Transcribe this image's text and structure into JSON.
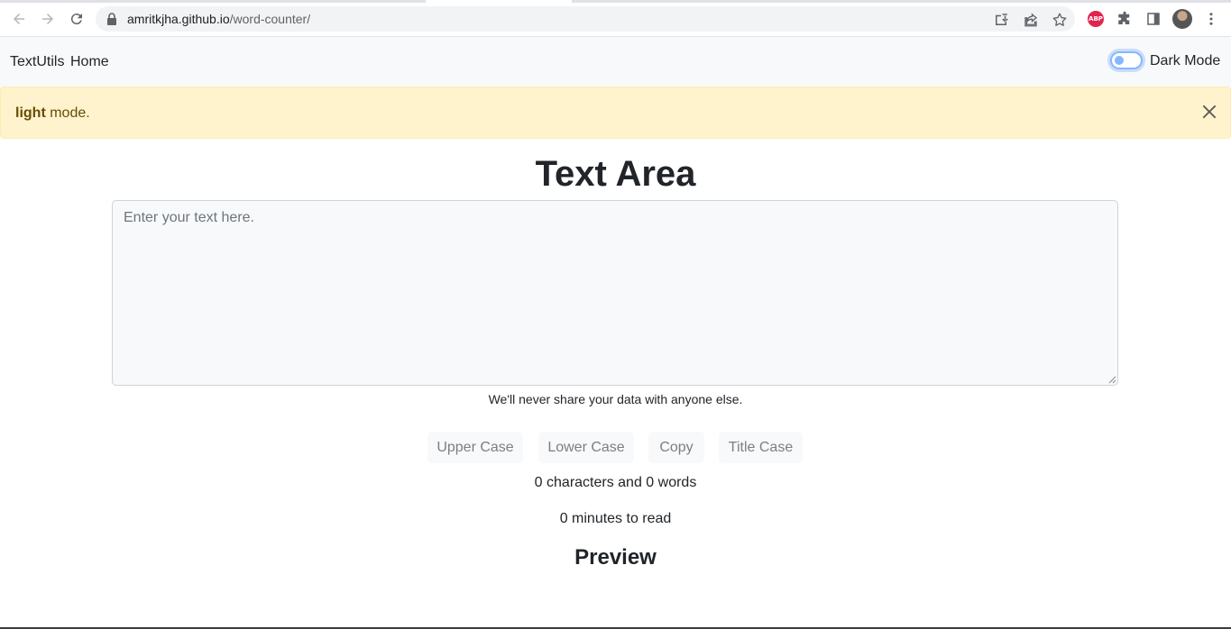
{
  "browser": {
    "url_host": "amritkjha.github.io",
    "url_path": "/word-counter/",
    "icons": [
      "back-icon",
      "forward-icon",
      "reload-icon",
      "lock-icon",
      "install-icon",
      "share-icon",
      "star-icon",
      "adblock-icon",
      "extensions-icon",
      "side-panel-icon",
      "profile-avatar",
      "menu-icon"
    ],
    "adblock_label": "ABP"
  },
  "navbar": {
    "brand": "TextUtils",
    "home": "Home",
    "toggle_label": "Dark Mode",
    "toggle_on": false
  },
  "alert": {
    "strong": "light",
    "rest": " mode."
  },
  "main": {
    "title": "Text Area",
    "textarea_placeholder": "Enter your text here.",
    "help_text": "We'll never share your data with anyone else.",
    "buttons": [
      "Upper Case",
      "Lower Case",
      "Copy",
      "Title Case"
    ],
    "stats": "0 characters and 0 words",
    "read_time": "0 minutes to read",
    "preview_heading": "Preview"
  },
  "colors": {
    "navbar_bg": "#f8f9fa",
    "alert_bg": "#fff3cd",
    "alert_text": "#664d03",
    "toggle_accent": "#86b7fe"
  }
}
